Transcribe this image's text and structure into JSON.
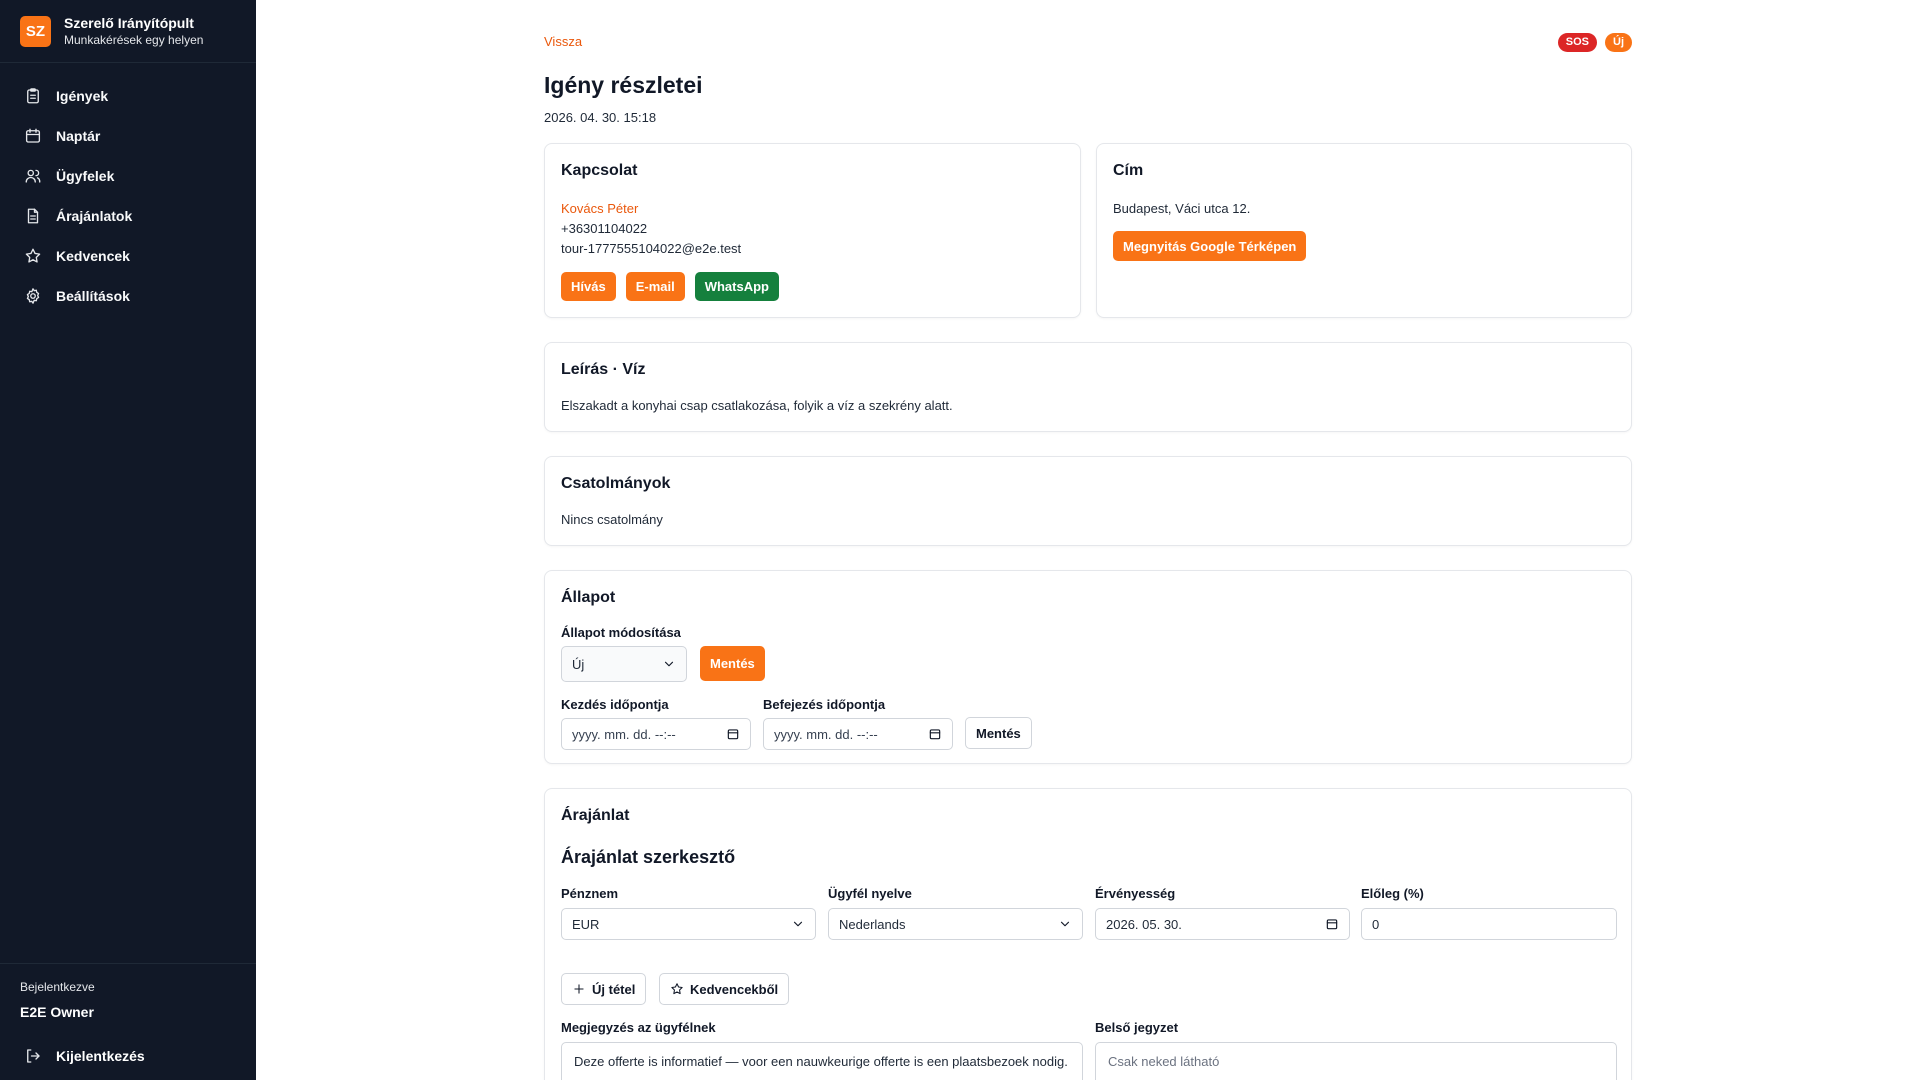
{
  "brand": {
    "initials": "SZ",
    "title": "Szerelő Irányítópult",
    "subtitle": "Munkakérések egy helyen",
    "color": "#f97316"
  },
  "nav": [
    {
      "label": "Igények",
      "icon": "clipboard-icon"
    },
    {
      "label": "Naptár",
      "icon": "calendar-icon"
    },
    {
      "label": "Ügyfelek",
      "icon": "users-icon"
    },
    {
      "label": "Árajánlatok",
      "icon": "document-icon"
    },
    {
      "label": "Kedvencek",
      "icon": "star-icon"
    },
    {
      "label": "Beállítások",
      "icon": "gear-icon"
    }
  ],
  "account": {
    "logged_in_label": "Bejelentkezve",
    "user": "E2E Owner",
    "logout_label": "Kijelentkezés"
  },
  "header": {
    "back_label": "Vissza",
    "badges": {
      "sos": "SOS",
      "new": "Új"
    },
    "title": "Igény részletei",
    "date": "2026. 04. 30. 15:18"
  },
  "contact": {
    "title": "Kapcsolat",
    "name": "Kovács Péter",
    "phone": "+36301104022",
    "email": "tour-1777555104022@e2e.test",
    "call_label": "Hívás",
    "email_label": "E-mail",
    "whatsapp_label": "WhatsApp"
  },
  "address": {
    "title": "Cím",
    "value": "Budapest, Váci utca 12.",
    "map_label": "Megnyitás Google Térképen"
  },
  "description": {
    "title": "Leírás · Víz",
    "text": "Elszakadt a konyhai csap csatlakozása, folyik a víz a szekrény alatt."
  },
  "attachments": {
    "title": "Csatolmányok",
    "empty": "Nincs csatolmány"
  },
  "status": {
    "title": "Állapot",
    "change_label": "Állapot módosítása",
    "selected": "Új",
    "save_label": "Mentés",
    "start_label": "Kezdés időpontja",
    "end_label": "Befejezés időpontja",
    "start_placeholder": "yyyy. mm. dd. --:--",
    "end_placeholder": "yyyy. mm. dd. --:--",
    "save_times_label": "Mentés"
  },
  "quote": {
    "title": "Árajánlat",
    "editor_title": "Árajánlat szerkesztő",
    "currency_label": "Pénznem",
    "currency_value": "EUR",
    "language_label": "Ügyfél nyelve",
    "language_value": "Nederlands",
    "validity_label": "Érvényesség",
    "validity_value": "2026. 05. 30.",
    "deposit_label": "Előleg (%)",
    "deposit_value": "0",
    "new_item_label": "Új tétel",
    "favorites_label": "Kedvencekből",
    "customer_note_label": "Megjegyzés az ügyfélnek",
    "customer_note_value": "Deze offerte is informatief — voor een nauwkeurige offerte is een plaatsbezoek nodig.",
    "internal_note_label": "Belső jegyzet",
    "internal_note_placeholder": "Csak neked látható"
  }
}
